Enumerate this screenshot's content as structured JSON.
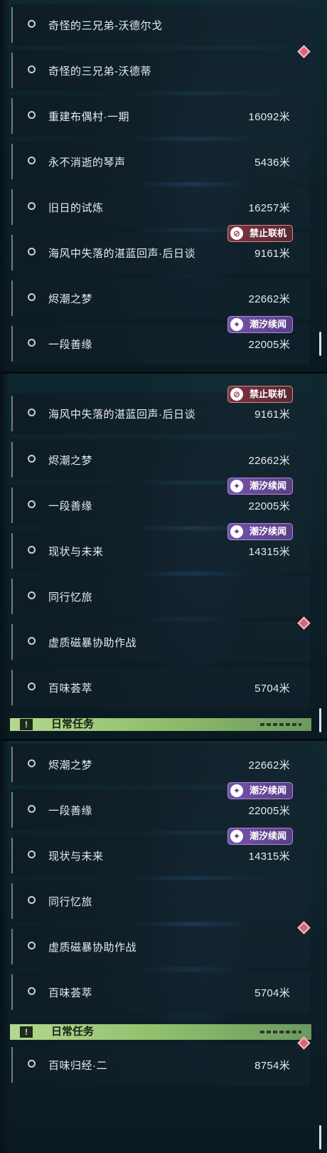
{
  "panel1": {
    "rows": [
      {
        "title": "奇怪的三兄弟-沃德尔戈",
        "distance": ""
      },
      {
        "title": "奇怪的三兄弟-沃德蒂",
        "distance": ""
      },
      {
        "title": "重建布偶村·一期",
        "distance": "16092米"
      },
      {
        "title": "永不消逝的琴声",
        "distance": "5436米"
      },
      {
        "title": "旧日的试炼",
        "distance": "16257米"
      },
      {
        "title": "海风中失落的湛蓝回声·后日谈",
        "distance": "9161米",
        "tag": "禁止联机"
      },
      {
        "title": "烬潮之梦",
        "distance": "22662米"
      },
      {
        "title": "一段善缘",
        "distance": "22005米",
        "tag": "潮汐续闻"
      }
    ]
  },
  "panel2": {
    "rows": [
      {
        "title": "海风中失落的湛蓝回声·后日谈",
        "distance": "9161米",
        "tag": "禁止联机"
      },
      {
        "title": "烬潮之梦",
        "distance": "22662米"
      },
      {
        "title": "一段善缘",
        "distance": "22005米",
        "tag": "潮汐续闻"
      },
      {
        "title": "现状与未来",
        "distance": "14315米",
        "tag": "潮汐续闻"
      },
      {
        "title": "同行忆旅",
        "distance": ""
      },
      {
        "title": "虚质磁暴协助作战",
        "distance": ""
      },
      {
        "title": "百味荟萃",
        "distance": "5704米"
      }
    ],
    "section_header": "日常任务"
  },
  "panel3": {
    "rows": [
      {
        "title": "烬潮之梦",
        "distance": "22662米"
      },
      {
        "title": "一段善缘",
        "distance": "22005米",
        "tag": "潮汐续闻"
      },
      {
        "title": "现状与未来",
        "distance": "14315米",
        "tag": "潮汐续闻"
      },
      {
        "title": "同行忆旅",
        "distance": ""
      },
      {
        "title": "虚质磁暴协助作战",
        "distance": ""
      },
      {
        "title": "百味荟萃",
        "distance": "5704米"
      },
      {
        "title": "百味归经·二",
        "distance": "8754米"
      }
    ],
    "section_header": "日常任务"
  },
  "header_icon": "!",
  "colors": {
    "tag_purple": "#6a4a9c",
    "tag_red": "#6e2e3a",
    "header_green": "#9fcb7a",
    "marker_pink": "#e0607a"
  },
  "icons": [
    "radio-circle-icon",
    "tidal-lore-icon",
    "no-coop-icon",
    "exclamation-icon",
    "pin-diamond-icon"
  ]
}
